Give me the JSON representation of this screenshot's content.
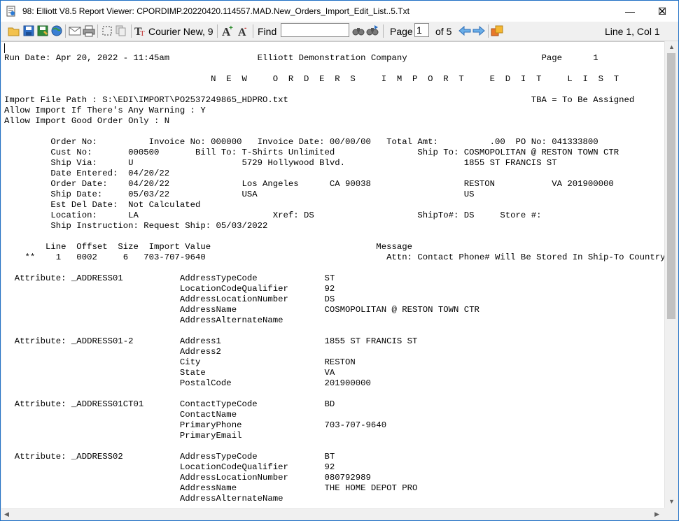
{
  "window": {
    "title": "98: Elliott V8.5 Report Viewer: CPORDIMP.20220420.114557.MAD.New_Orders_Import_Edit_List..5.Txt",
    "controls": {
      "minimize": "—",
      "maximize": "☐",
      "close": "✕"
    }
  },
  "toolbar": {
    "font_label": "Courier New, 9",
    "find_label": "Find",
    "find_value": "",
    "page_label": "Page",
    "page_value": "1",
    "of_pages": "of 5",
    "cursor_position": "Line 1, Col 1",
    "icons": [
      "open-folder-icon",
      "save-icon",
      "save-as-icon",
      "globe-icon",
      "email-icon",
      "print-icon",
      "select-all-icon",
      "copy-icon",
      "font-icon",
      "increase-font-icon",
      "decrease-font-icon",
      "find-binoculars-icon",
      "find-next-binoculars-icon",
      "previous-page-icon",
      "next-page-icon",
      "export-icon"
    ]
  },
  "report": {
    "lines": [
      "Run Date: Apr 20, 2022 - 11:45am                 Elliott Demonstration Company                          Page      1",
      "",
      "                                        N  E  W     O  R  D  E  R  S     I  M  P  O  R  T     E  D  I  T     L  I  S  T",
      "",
      "Import File Path : S:\\EDI\\IMPORT\\PO2537249865_HDPRO.txt                                               TBA = To Be Assigned",
      "Allow Import If There's Any Warning : Y",
      "Allow Import Good Order Only : N",
      "",
      "         Order No:          Invoice No: 000000   Invoice Date: 00/00/00   Total Amt:          .00  PO No: 041333800",
      "         Cust No:       000500       Bill To: T-Shirts Unlimited                Ship To: COSMOPOLITAN @ RESTON TOWN CTR",
      "         Ship Via:      U                     5729 Hollywood Blvd.                       1855 ST FRANCIS ST",
      "         Date Entered:  04/20/22",
      "         Order Date:    04/20/22              Los Angeles      CA 90038                  RESTON           VA 201900000",
      "         Ship Date:     05/03/22              USA                                        US",
      "         Est Del Date:  Not Calculated",
      "         Location:      LA                          Xref: DS                    ShipTo#: DS     Store #:",
      "         Ship Instruction: Request Ship: 05/03/2022",
      "",
      "        Line  Offset  Size  Import Value                                Message",
      "    **    1   0002     6   703-707-9640                                   Attn: Contact Phone# Will Be Stored In Ship-To Country  **",
      "",
      "  Attribute: _ADDRESS01           AddressTypeCode             ST",
      "                                  LocationCodeQualifier       92",
      "                                  AddressLocationNumber       DS",
      "                                  AddressName                 COSMOPOLITAN @ RESTON TOWN CTR",
      "                                  AddressAlternateName",
      "",
      "  Attribute: _ADDRESS01-2         Address1                    1855 ST FRANCIS ST",
      "                                  Address2",
      "                                  City                        RESTON",
      "                                  State                       VA",
      "                                  PostalCode                  201900000",
      "",
      "  Attribute: _ADDRESS01CT01       ContactTypeCode             BD",
      "                                  ContactName",
      "                                  PrimaryPhone                703-707-9640",
      "                                  PrimaryEmail",
      "",
      "  Attribute: _ADDRESS02           AddressTypeCode             BT",
      "                                  LocationCodeQualifier       92",
      "                                  AddressLocationNumber       080792989",
      "                                  AddressName                 THE HOME DEPOT PRO",
      "                                  AddressAlternateName"
    ]
  }
}
